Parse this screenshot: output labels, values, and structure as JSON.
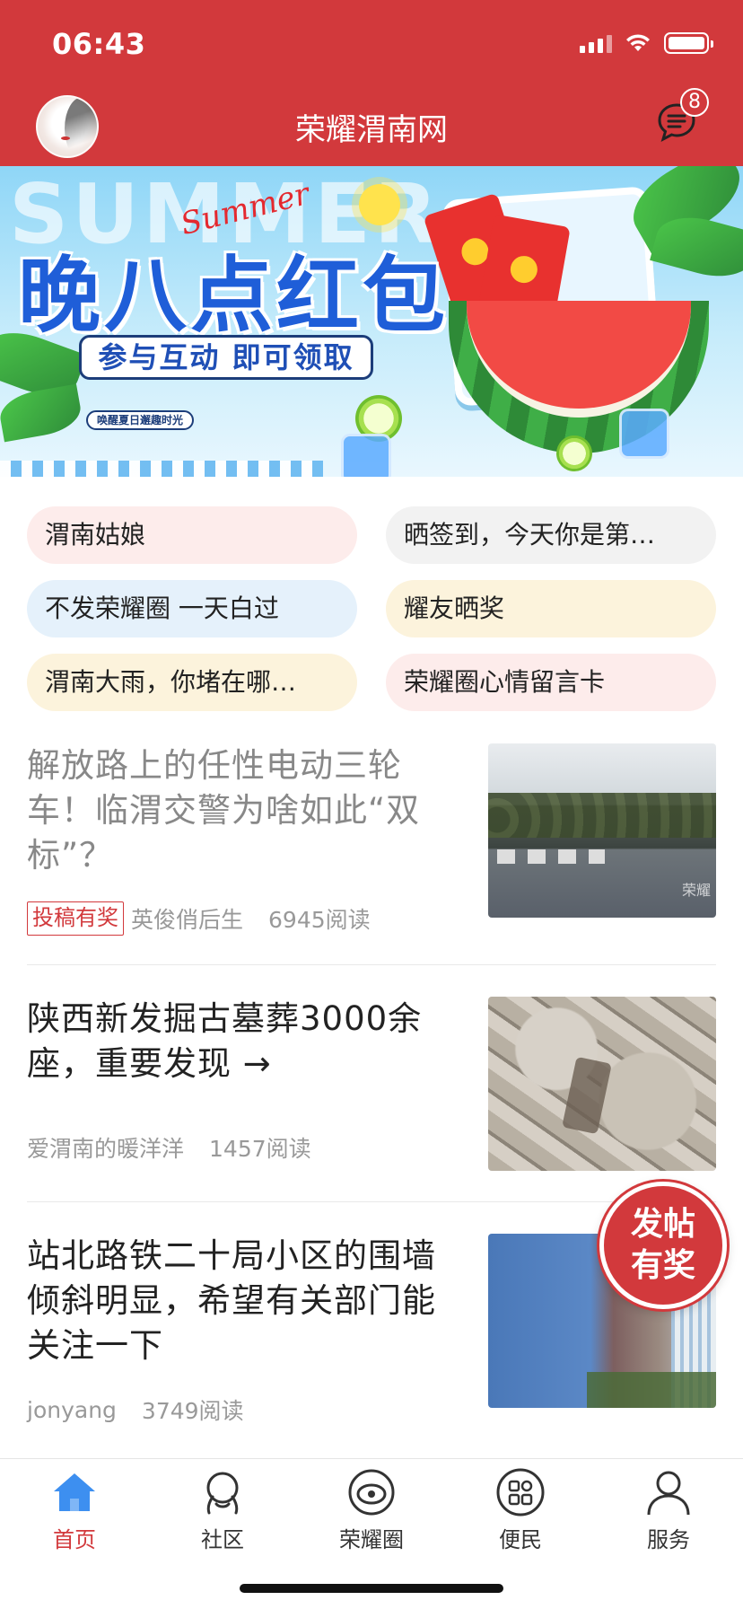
{
  "status": {
    "time": "06:43"
  },
  "header": {
    "title": "荣耀渭南网",
    "message_badge": "8"
  },
  "banner": {
    "bg_word": "SUMMER",
    "script_word": "Summer",
    "headline": "晚八点红包",
    "cta": "参与互动 即可领取",
    "tag": "唤醒夏日邂趣时光"
  },
  "topics": [
    {
      "label": "渭南姑娘",
      "color": "pink"
    },
    {
      "label": "晒签到，今天你是第…",
      "color": "gray"
    },
    {
      "label": "不发荣耀圈  一天白过",
      "color": "blue"
    },
    {
      "label": "耀友晒奖",
      "color": "yellow"
    },
    {
      "label": "渭南大雨，你堵在哪…",
      "color": "yellow"
    },
    {
      "label": "荣耀圈心情留言卡",
      "color": "pink"
    }
  ],
  "articles": [
    {
      "title": "解放路上的任性电动三轮车！临渭交警为啥如此“双标”？",
      "badge": "投稿有奖",
      "author": "英俊俏后生",
      "reads": "6945阅读",
      "thumb_watermark": "荣耀"
    },
    {
      "title": "陕西新发掘古墓葬3000余座，重要发现 →",
      "author": "爱渭南的暖洋洋",
      "reads": "1457阅读"
    },
    {
      "title": "站北路铁二十局小区的围墙倾斜明显，希望有关部门能关注一下",
      "author": "jonyang",
      "reads": "3749阅读"
    }
  ],
  "fab": {
    "line1": "发帖",
    "line2": "有奖"
  },
  "tabbar": [
    {
      "label": "首页",
      "icon": "home-icon",
      "active": true
    },
    {
      "label": "社区",
      "icon": "community-icon",
      "active": false
    },
    {
      "label": "荣耀圈",
      "icon": "circle-icon",
      "active": false
    },
    {
      "label": "便民",
      "icon": "services-grid-icon",
      "active": false
    },
    {
      "label": "服务",
      "icon": "user-icon",
      "active": false
    }
  ],
  "colors": {
    "brand_red": "#d2393c",
    "tab_active_blue": "#3d8ff0"
  }
}
